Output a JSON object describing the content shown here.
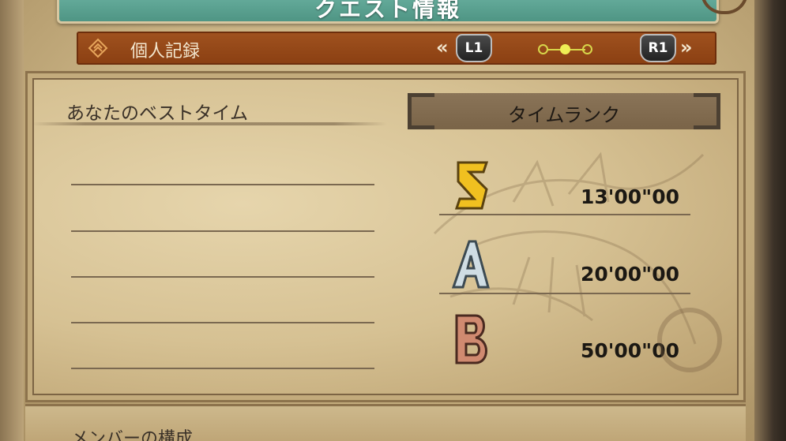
{
  "title": "クエスト情報",
  "header": {
    "label": "個人記録",
    "left_chevron": "«",
    "right_chevron": "»",
    "left_button": "L1",
    "right_button": "R1",
    "page_count": 3,
    "active_page": 2
  },
  "best_time": {
    "label": "あなたのベストタイム",
    "rows": [
      "",
      "",
      "",
      "",
      ""
    ]
  },
  "rank": {
    "header": "タイムランク",
    "rows": [
      {
        "rank": "S",
        "time": "13'00\"00",
        "icon": "rank-s-icon"
      },
      {
        "rank": "A",
        "time": "20'00\"00",
        "icon": "rank-a-icon"
      },
      {
        "rank": "B",
        "time": "50'00\"00",
        "icon": "rank-b-icon"
      }
    ]
  },
  "members": {
    "label": "メンバーの構成"
  },
  "colors": {
    "title_banner": "#5fa595",
    "header_bar": "#963f12",
    "rank_s": "#f0c020",
    "rank_a": "#c8d8e0",
    "rank_b": "#c87860"
  }
}
